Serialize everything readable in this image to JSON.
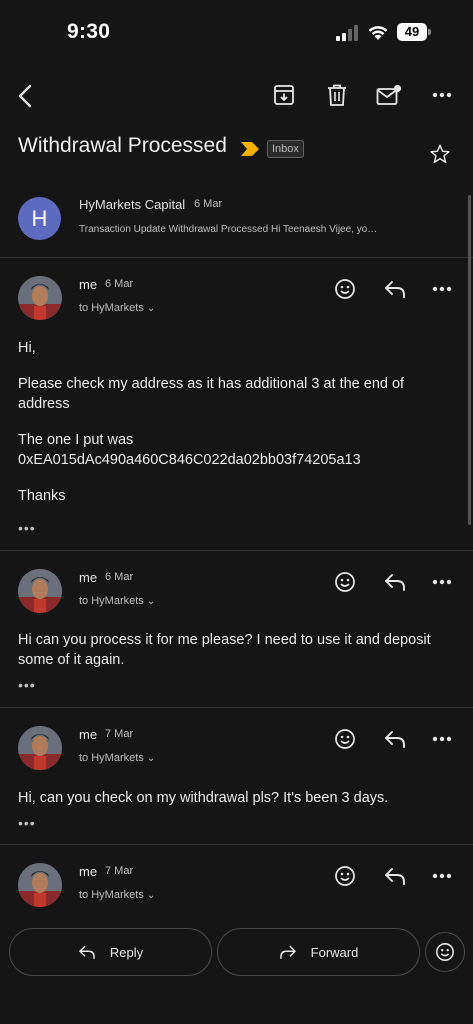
{
  "status": {
    "time": "9:30",
    "battery": "49"
  },
  "email": {
    "subject": "Withdrawal Processed",
    "label": "Inbox",
    "sender": {
      "avatar_letter": "H",
      "name": "HyMarkets Capital",
      "date": "6 Mar",
      "snippet": "Transaction Update Withdrawal Processed Hi Teenaesh Vijee, yo…"
    }
  },
  "messages": [
    {
      "from": "me",
      "date": "6 Mar",
      "to": "to HyMarkets",
      "body": [
        "Hi,",
        "Please check my address as it has additional 3 at the end of address",
        "The one I put was 0xEA015dAc490a460C846C022da02bb03f74205a13",
        "Thanks"
      ]
    },
    {
      "from": "me",
      "date": "6 Mar",
      "to": "to HyMarkets",
      "body": [
        "Hi can you process it for me please? I need to use it and deposit some of it again."
      ]
    },
    {
      "from": "me",
      "date": "7 Mar",
      "to": "to HyMarkets",
      "body": [
        "Hi, can you check on my withdrawal pls? It's been 3 days."
      ]
    },
    {
      "from": "me",
      "date": "7 Mar",
      "to": "to HyMarkets",
      "body": []
    }
  ],
  "more_indicator": "•••",
  "actions": {
    "reply": "Reply",
    "forward": "Forward"
  },
  "colors": {
    "background": "#151515",
    "avatar": "#5c6bc0",
    "label_marker": "#f2b100"
  }
}
